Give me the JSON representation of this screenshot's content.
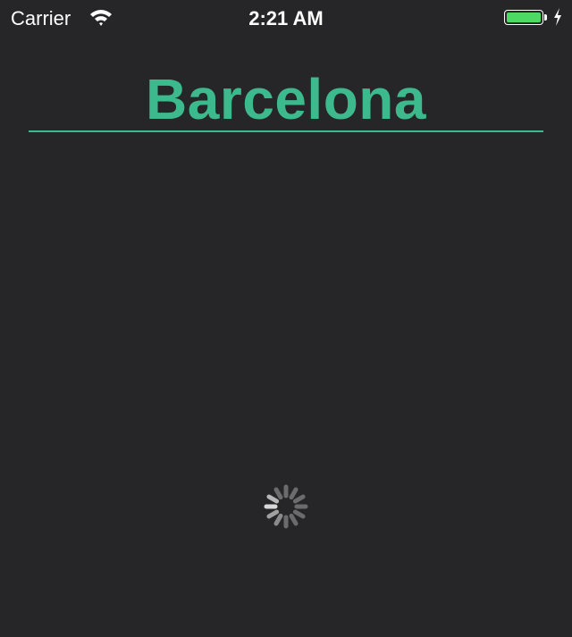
{
  "status_bar": {
    "carrier": "Carrier",
    "time": "2:21 AM",
    "battery_color": "#4cd964"
  },
  "header": {
    "title": "Barcelona",
    "accent_color": "#3dba8d"
  },
  "loading": {
    "icon": "activity-spinner-icon"
  }
}
